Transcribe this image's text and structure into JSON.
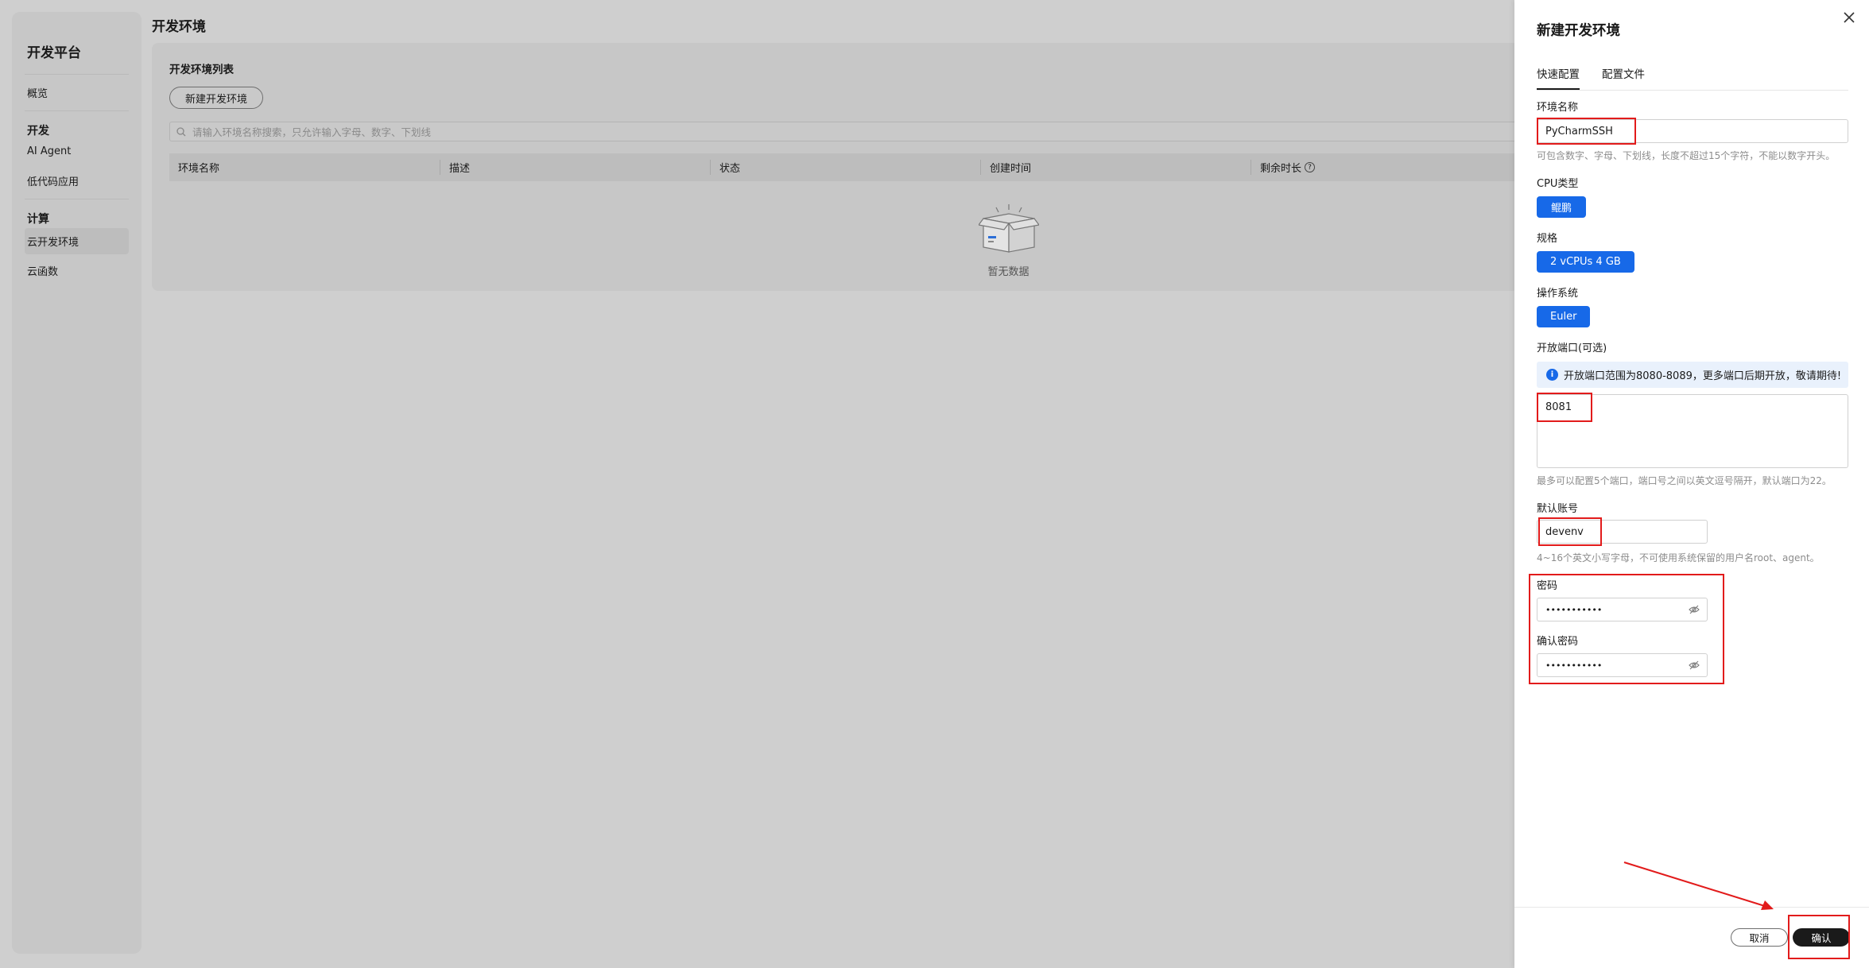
{
  "sidebar": {
    "title": "开发平台",
    "overview": "概览",
    "groups": [
      {
        "label": "开发",
        "items": [
          {
            "label": "AI Agent"
          },
          {
            "label": "低代码应用"
          }
        ]
      },
      {
        "label": "计算",
        "items": [
          {
            "label": "云开发环境"
          },
          {
            "label": "云函数"
          }
        ]
      }
    ]
  },
  "main": {
    "page_title": "开发环境",
    "panel_title": "开发环境列表",
    "new_button": "新建开发环境",
    "search_placeholder": "请输入环境名称搜索，只允许输入字母、数字、下划线",
    "columns": [
      "环境名称",
      "描述",
      "状态",
      "创建时间",
      "剩余时长"
    ],
    "remaining_help": "?",
    "empty_text": "暂无数据"
  },
  "drawer": {
    "title": "新建开发环境",
    "tabs": [
      "快速配置",
      "配置文件"
    ],
    "env_name": {
      "label": "环境名称",
      "value": "PyCharmSSH",
      "hint": "可包含数字、字母、下划线，长度不超过15个字符，不能以数字开头。"
    },
    "cpu": {
      "label": "CPU类型",
      "value": "鲲鹏"
    },
    "spec": {
      "label": "规格",
      "value": "2 vCPUs 4 GB"
    },
    "os": {
      "label": "操作系统",
      "value": "Euler"
    },
    "ports": {
      "label": "开放端口(可选)",
      "notice": "开放端口范围为8080-8089，更多端口后期开放，敬请期待!",
      "value": "8081",
      "hint": "最多可以配置5个端口，端口号之间以英文逗号隔开，默认端口为22。"
    },
    "account": {
      "label": "默认账号",
      "value": "devenv",
      "hint": "4~16个英文小写字母，不可使用系统保留的用户名root、agent。"
    },
    "password": {
      "label": "密码",
      "value": "•••••••••••"
    },
    "confirm_password": {
      "label": "确认密码",
      "value": "•••••••••••"
    },
    "cancel": "取消",
    "confirm": "确认"
  },
  "colors": {
    "accent": "#1769e8",
    "annotation": "#e21b1b"
  },
  "icons": [
    "search-icon",
    "help-icon",
    "empty-box-icon",
    "close-icon",
    "info-icon",
    "eye-icon"
  ]
}
